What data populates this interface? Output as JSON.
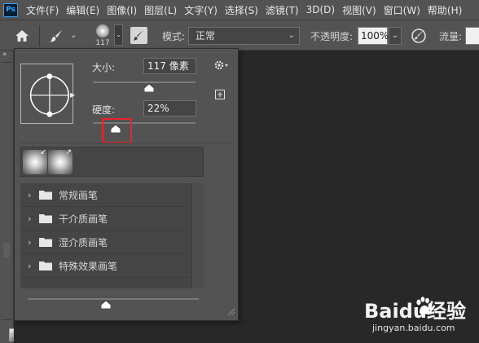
{
  "app": {
    "logo": "Ps"
  },
  "menubar": {
    "items": [
      "文件(F)",
      "编辑(E)",
      "图像(I)",
      "图层(L)",
      "文字(Y)",
      "选择(S)",
      "滤镜(T)",
      "3D(D)",
      "视图(V)",
      "窗口(W)",
      "帮助(H)"
    ]
  },
  "options_bar": {
    "brush_size_preview": "117",
    "mode_label": "模式:",
    "mode_value": "正常",
    "opacity_label": "不透明度:",
    "opacity_value": "100%",
    "flow_label": "流量:"
  },
  "brush_panel": {
    "size_label": "大小:",
    "size_value": "117 像素",
    "size_fraction": 0.55,
    "hardness_label": "硬度:",
    "hardness_value": "22%",
    "hardness_fraction": 0.22,
    "folders": [
      "常规画笔",
      "干介质画笔",
      "湿介质画笔",
      "特殊效果画笔"
    ],
    "highlight_color": "#e8242b"
  },
  "watermark": {
    "brand": "Baidu经验",
    "url": "jingyan.baidu.com"
  },
  "colors": {
    "panel_bg": "#535353",
    "canvas_bg": "#282828",
    "accent_ps": "#31a8ff"
  }
}
